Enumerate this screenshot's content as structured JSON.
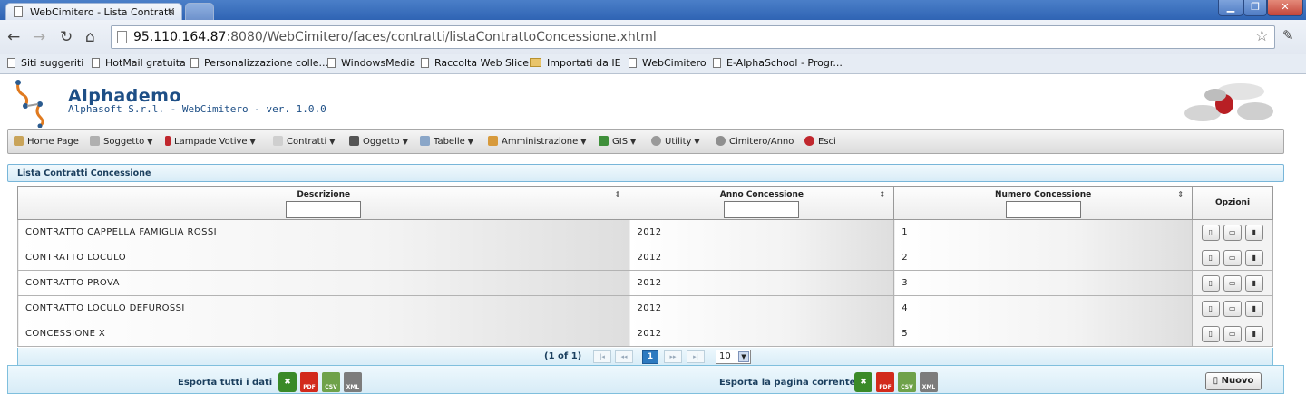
{
  "browser": {
    "tab_title": "WebCimitero - Lista Contratti",
    "tab_close": "×",
    "url_host": "95.110.164.87",
    "url_rest": ":8080/WebCimitero/faces/contratti/listaContrattoConcessione.xhtml",
    "nav_back": "←",
    "nav_forward": "→",
    "nav_reload": "↻",
    "nav_home": "⌂",
    "star": "☆",
    "wrench": "✎",
    "win_min": "▁",
    "win_max": "❐",
    "win_close": "✕",
    "bookmarks": [
      {
        "label": "Siti suggeriti",
        "icon": "page-icon"
      },
      {
        "label": "HotMail gratuita",
        "icon": "page-icon"
      },
      {
        "label": "Personalizzazione colle...",
        "icon": "page-icon"
      },
      {
        "label": "WindowsMedia",
        "icon": "page-icon"
      },
      {
        "label": "Raccolta Web Slice",
        "icon": "page-icon"
      },
      {
        "label": "Importati da IE",
        "icon": "folder-icon"
      },
      {
        "label": "WebCimitero",
        "icon": "page-icon"
      },
      {
        "label": "E-AlphaSchool - Progr...",
        "icon": "page-icon"
      }
    ]
  },
  "app": {
    "title": "Alphademo",
    "subtitle": "Alphasoft S.r.l. - WebCimitero - ver. 1.0.0"
  },
  "menu": [
    {
      "label": "Home Page",
      "dropdown": false,
      "color": "#c9a45a"
    },
    {
      "label": "Soggetto",
      "dropdown": true,
      "color": "#b0b0b0"
    },
    {
      "label": "Lampade Votive",
      "dropdown": true,
      "color": "#c0272d"
    },
    {
      "label": "Contratti",
      "dropdown": true,
      "color": "#cfcfcf"
    },
    {
      "label": "Oggetto",
      "dropdown": true,
      "color": "#555555"
    },
    {
      "label": "Tabelle",
      "dropdown": true,
      "color": "#8aa6c8"
    },
    {
      "label": "Amministrazione",
      "dropdown": true,
      "color": "#d79a3c"
    },
    {
      "label": "GIS",
      "dropdown": true,
      "color": "#3f8f3a"
    },
    {
      "label": "Utility",
      "dropdown": true,
      "color": "#9a9a9a"
    },
    {
      "label": "Cimitero/Anno",
      "dropdown": false,
      "color": "#8f8f8f"
    },
    {
      "label": "Esci",
      "dropdown": false,
      "color": "#c0272d"
    }
  ],
  "panel": {
    "title": "Lista Contratti Concessione"
  },
  "table": {
    "columns": [
      "Descrizione",
      "Anno Concessione",
      "Numero Concessione",
      "Opzioni"
    ],
    "sort_glyph": "⇕",
    "rows": [
      [
        "CONTRATTO CAPPELLA FAMIGLIA ROSSI",
        "2012",
        "1"
      ],
      [
        "CONTRATTO LOCULO",
        "2012",
        "2"
      ],
      [
        "CONTRATTO PROVA",
        "2012",
        "3"
      ],
      [
        "CONTRATTO LOCULO DEFUROSSI",
        "2012",
        "4"
      ],
      [
        "CONCESSIONE X",
        "2012",
        "5"
      ]
    ],
    "row_actions": {
      "view": "▯",
      "open": "▭",
      "delete": "▮"
    }
  },
  "pager": {
    "count": "(1 of 1)",
    "first": "|◂",
    "prev": "◂◂",
    "current": "1",
    "next": "▸▸",
    "last": "▸|",
    "rows_per_page": "10",
    "dropdown": "▼"
  },
  "export": {
    "all_label": "Esporta tutti i dati",
    "page_label": "Esporta la pagina corrente",
    "xls": "✖",
    "pdf": "PDF",
    "csv": "CSV",
    "xml": "XML",
    "new_button": "Nuovo",
    "new_icon": "▯"
  }
}
